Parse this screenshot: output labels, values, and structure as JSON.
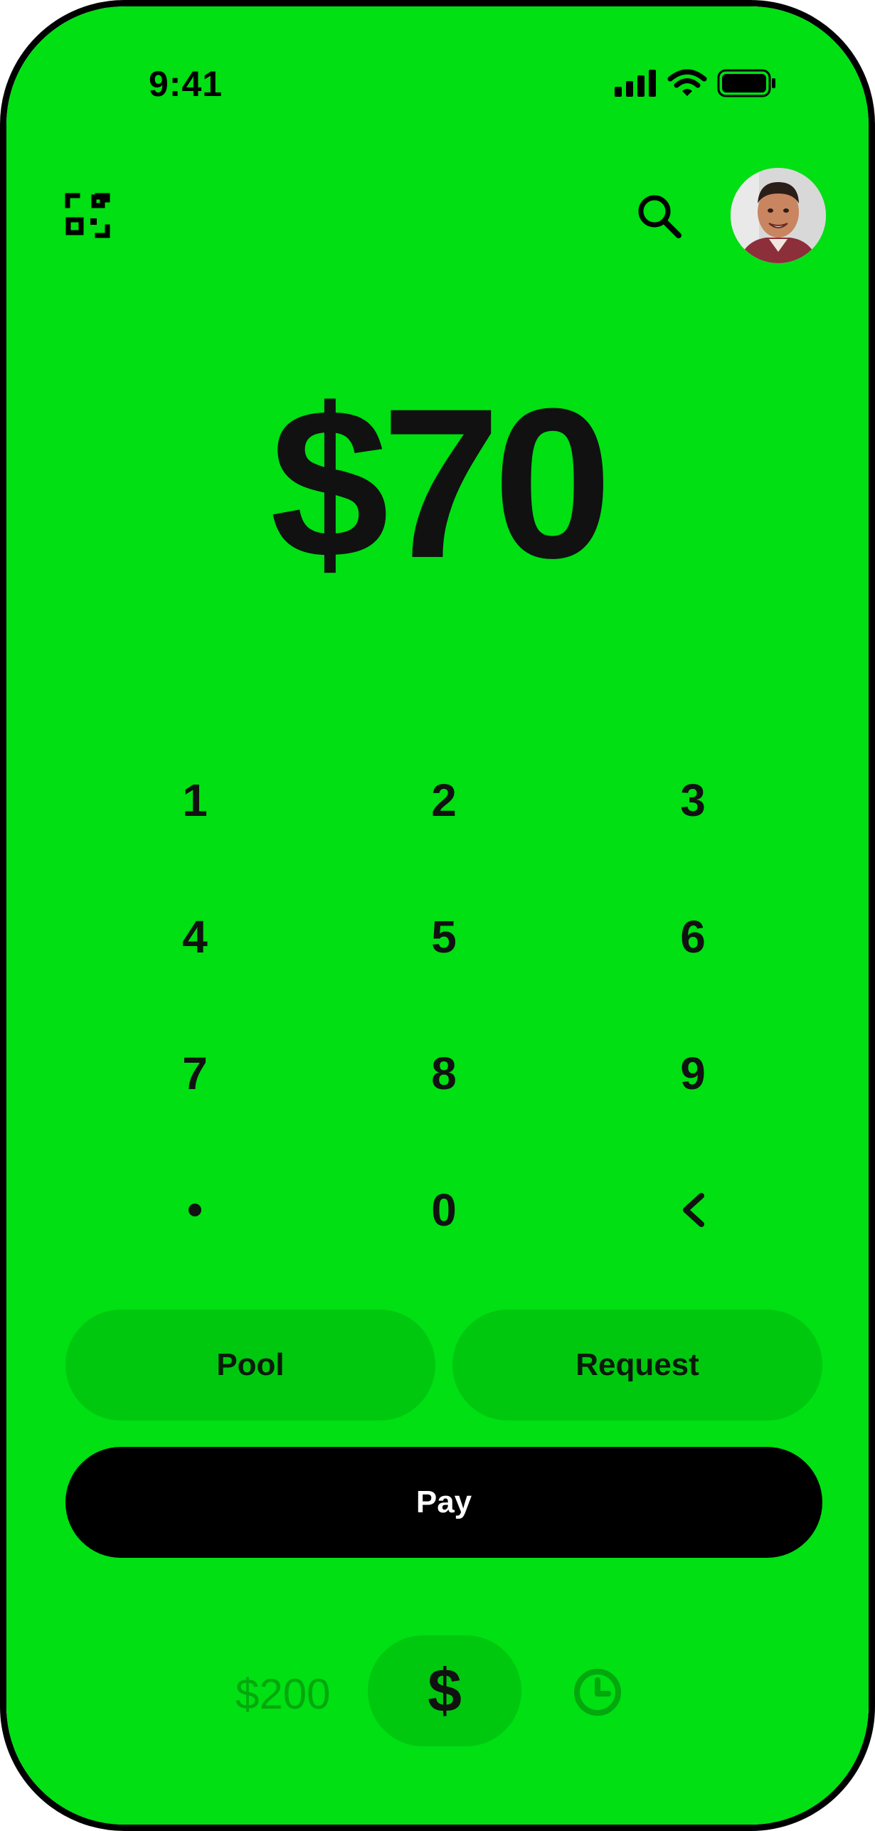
{
  "status_bar": {
    "time": "9:41"
  },
  "header": {
    "scan_icon": "qr-scan-icon",
    "search_icon": "search-icon",
    "avatar": "profile-avatar"
  },
  "amount": {
    "display": "$70"
  },
  "keypad": {
    "keys": [
      "1",
      "2",
      "3",
      "4",
      "5",
      "6",
      "7",
      "8",
      "9",
      "0"
    ],
    "decimal_icon": "decimal-dot-icon",
    "backspace_icon": "backspace-chevron-icon"
  },
  "actions": {
    "pool_label": "Pool",
    "request_label": "Request",
    "pay_label": "Pay"
  },
  "bottom_nav": {
    "balance": "$200",
    "cash_symbol": "$",
    "activity_icon": "clock-icon"
  },
  "colors": {
    "background": "#00E013",
    "pill": "#00C80F",
    "pay_button": "#000000",
    "muted_green": "#03A80D"
  }
}
